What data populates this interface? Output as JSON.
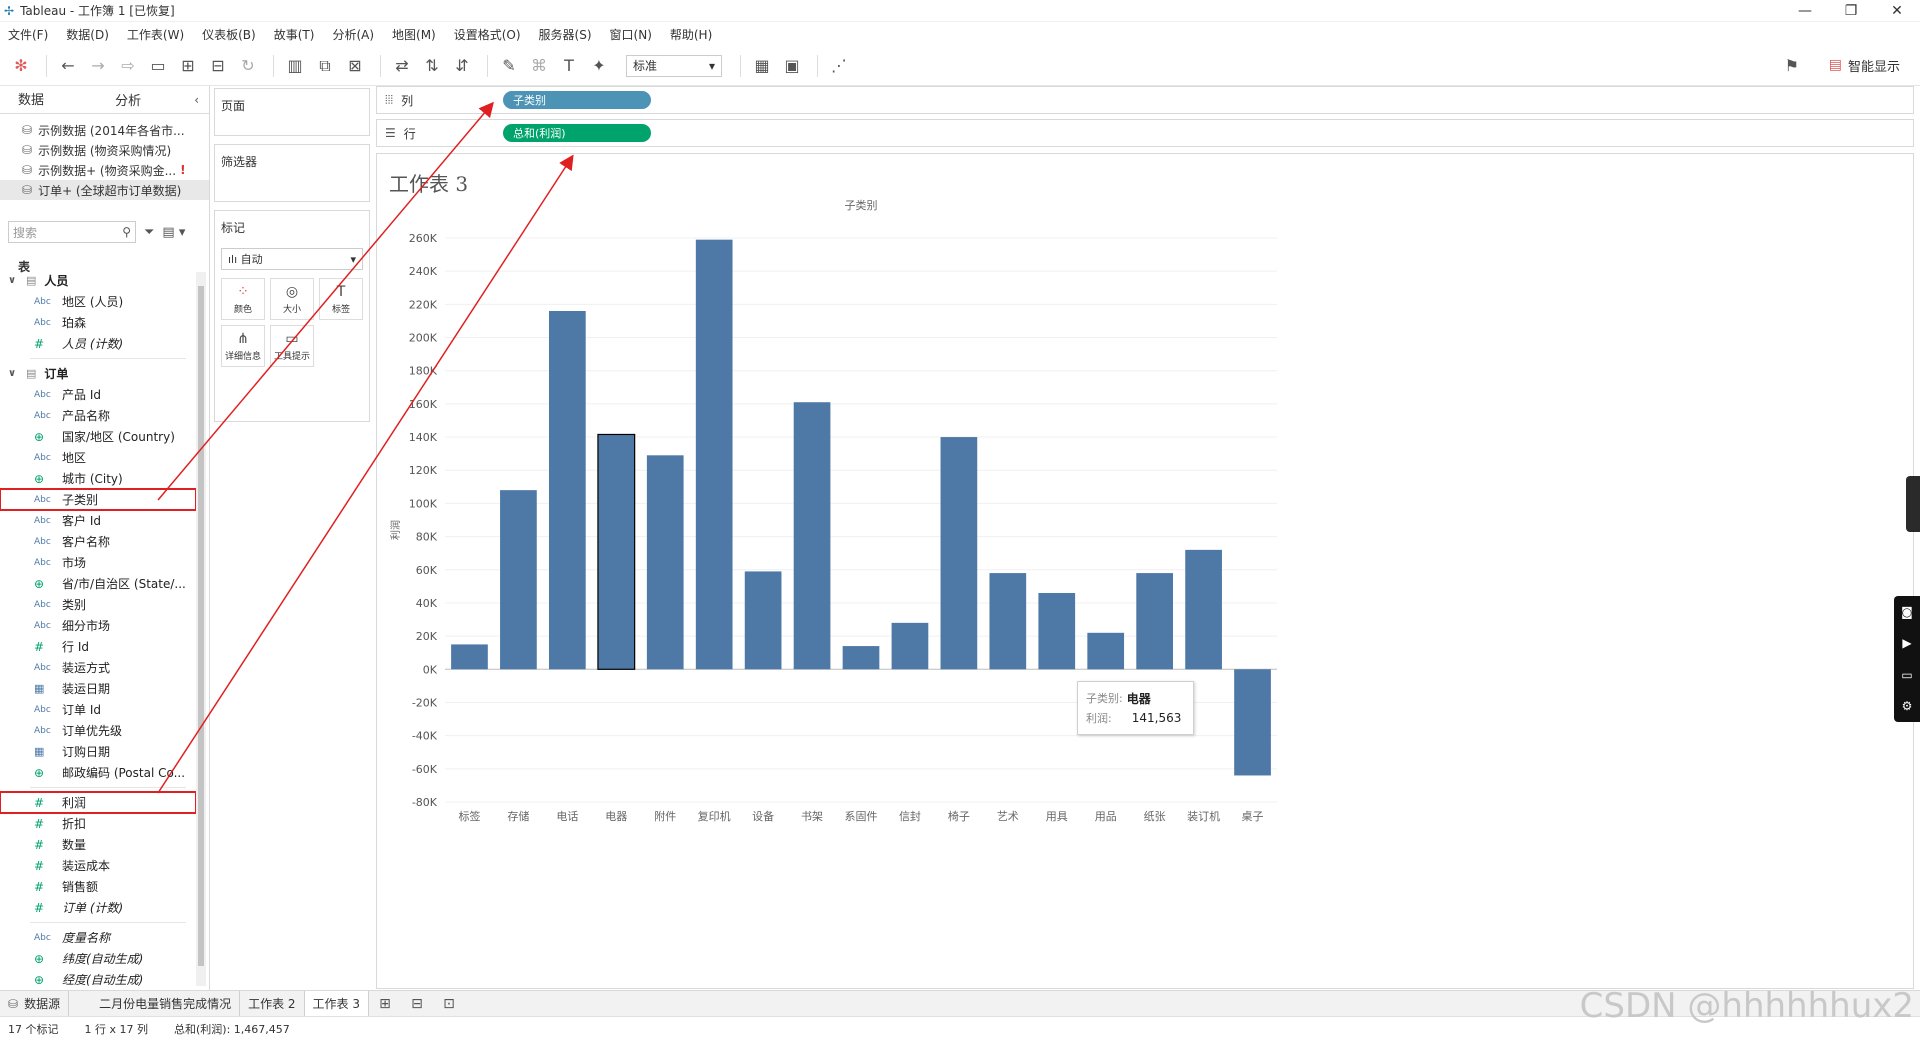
{
  "window": {
    "title": "Tableau - 工作簿 1 [已恢复]",
    "controls": [
      "—",
      "❐",
      "✕"
    ]
  },
  "menu": [
    "文件(F)",
    "数据(D)",
    "工作表(W)",
    "仪表板(B)",
    "故事(T)",
    "分析(A)",
    "地图(M)",
    "设置格式(O)",
    "服务器(S)",
    "窗口(N)",
    "帮助(H)"
  ],
  "toolbar": {
    "fit_select": "标准",
    "smart_show": "智能显示"
  },
  "data_pane": {
    "tab_data": "数据",
    "tab_analysis": "分析",
    "datasources": [
      {
        "label": "示例数据 (2014年各省市..."
      },
      {
        "label": "示例数据 (物资采购情况)"
      },
      {
        "label": "示例数据+ (物资采购金..."
      },
      {
        "label": "订单+ (全球超市订单数据)"
      }
    ],
    "search_placeholder": "搜索",
    "tables_heading": "表",
    "group_people": "人员",
    "people_fields": [
      {
        "type": "Abc",
        "label": "地区 (人员)"
      },
      {
        "type": "Abc",
        "label": "珀森"
      },
      {
        "type": "#",
        "label": "人员 (计数)"
      }
    ],
    "group_orders": "订单",
    "order_fields": [
      {
        "type": "Abc",
        "label": "产品 Id"
      },
      {
        "type": "Abc",
        "label": "产品名称"
      },
      {
        "type": "⊕",
        "label": "国家/地区 (Country)"
      },
      {
        "type": "Abc",
        "label": "地区"
      },
      {
        "type": "⊕",
        "label": "城市 (City)"
      },
      {
        "type": "Abc",
        "label": "子类别"
      },
      {
        "type": "Abc",
        "label": "客户 Id"
      },
      {
        "type": "Abc",
        "label": "客户名称"
      },
      {
        "type": "Abc",
        "label": "市场"
      },
      {
        "type": "⊕",
        "label": "省/市/自治区 (State/..."
      },
      {
        "type": "Abc",
        "label": "类别"
      },
      {
        "type": "Abc",
        "label": "细分市场"
      },
      {
        "type": "#",
        "label": "行 Id"
      },
      {
        "type": "Abc",
        "label": "装运方式"
      },
      {
        "type": "▦",
        "label": "装运日期"
      },
      {
        "type": "Abc",
        "label": "订单 Id"
      },
      {
        "type": "Abc",
        "label": "订单优先级"
      },
      {
        "type": "▦",
        "label": "订购日期"
      },
      {
        "type": "⊕",
        "label": "邮政编码 (Postal Co..."
      }
    ],
    "measure_fields": [
      {
        "type": "#",
        "label": "利润"
      },
      {
        "type": "#",
        "label": "折扣"
      },
      {
        "type": "#",
        "label": "数量"
      },
      {
        "type": "#",
        "label": "装运成本"
      },
      {
        "type": "#",
        "label": "销售额"
      },
      {
        "type": "#",
        "label": "订单 (计数)"
      }
    ],
    "extra_fields": [
      {
        "type": "Abc",
        "label": "度量名称"
      },
      {
        "type": "⊕",
        "label": "纬度(自动生成)"
      },
      {
        "type": "⊕",
        "label": "经度(自动生成)"
      }
    ]
  },
  "shelves": {
    "pages": "页面",
    "filters": "筛选器",
    "marks": "标记",
    "marks_type": "自动",
    "mark_buttons": [
      "颜色",
      "大小",
      "标签",
      "详细信息",
      "工具提示"
    ],
    "columns_label": "列",
    "rows_label": "行",
    "columns_pill": "子类别",
    "rows_pill": "总和(利润)"
  },
  "view": {
    "sheet_title": "工作表 3",
    "tooltip": {
      "key1": "子类别:",
      "val1": "电器",
      "key2": "利润:",
      "val2": "141,563"
    }
  },
  "chart_data": {
    "type": "bar",
    "title": "子类别",
    "xlabel": "",
    "ylabel": "利润",
    "categories": [
      "标签",
      "存储",
      "电话",
      "电器",
      "附件",
      "复印机",
      "设备",
      "书架",
      "系固件",
      "信封",
      "椅子",
      "艺术",
      "用具",
      "用品",
      "纸张",
      "装订机",
      "桌子"
    ],
    "values": [
      15000,
      108000,
      216000,
      141563,
      129000,
      259000,
      59000,
      161000,
      14000,
      28000,
      140000,
      58000,
      46000,
      22000,
      58000,
      72000,
      -64000
    ],
    "ylim": [
      -80000,
      260000
    ],
    "yticks": [
      "260K",
      "240K",
      "220K",
      "200K",
      "180K",
      "160K",
      "140K",
      "120K",
      "100K",
      "80K",
      "60K",
      "40K",
      "20K",
      "0K",
      "-20K",
      "-40K",
      "-60K",
      "-80K"
    ],
    "color": "#4e79a7",
    "highlighted_category": "电器"
  },
  "sheet_tabs": {
    "datasource": "数据源",
    "tabs": [
      "二月份电量销售完成情况",
      "工作表 2",
      "工作表 3"
    ]
  },
  "status": {
    "marks": "17 个标记",
    "rows_cols": "1 行 x 17 列",
    "sum": "总和(利润): 1,467,457"
  },
  "watermark": "CSDN @hhhhhhux2"
}
